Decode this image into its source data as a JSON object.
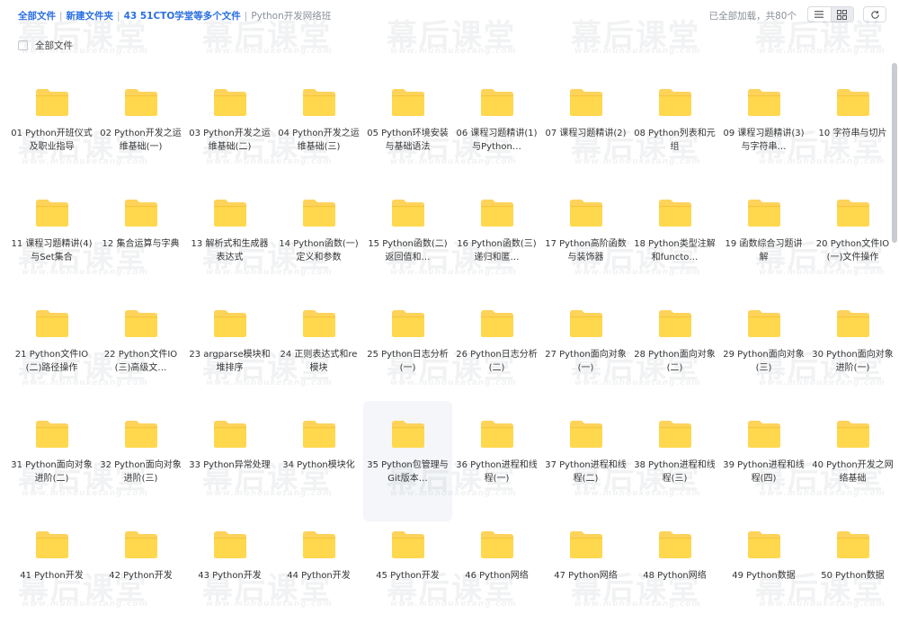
{
  "breadcrumb": {
    "items": [
      "全部文件",
      "新建文件夹",
      "43 51CTO学堂等多个文件"
    ],
    "current": "Python开发网络班",
    "separator": "|"
  },
  "status": {
    "loaded_text": "已全部加载，共80个"
  },
  "toolbar": {
    "list_view_icon": "list-icon",
    "grid_view_icon": "grid-icon",
    "refresh_icon": "refresh-icon",
    "active_view": "grid"
  },
  "select_all": {
    "label": "全部文件",
    "checked": false
  },
  "folder_color": "#fdd35a",
  "folders": [
    "01 Python开班仪式及职业指导",
    "02 Python开发之运维基础(一)",
    "03 Python开发之运维基础(二)",
    "04 Python开发之运维基础(三)",
    "05 Python环境安装与基础语法",
    "06 课程习题精讲(1)与Python…",
    "07 课程习题精讲(2)",
    "08 Python列表和元组",
    "09 课程习题精讲(3)与字符串…",
    "10 字符串与切片",
    "11 课程习题精讲(4)与Set集合",
    "12 集合运算与字典",
    "13 解析式和生成器表达式",
    "14 Python函数(一)定义和参数",
    "15 Python函数(二)返回值和…",
    "16 Python函数(三)递归和匿…",
    "17 Python高阶函数与装饰器",
    "18 Python类型注解和functo…",
    "19 函数综合习题讲解",
    "20 Python文件IO(一)文件操作",
    "21 Python文件IO(二)路径操作",
    "22 Python文件IO(三)高级文…",
    "23 argparse模块和堆排序",
    "24 正则表达式和re模块",
    "25 Python日志分析(一)",
    "26 Python日志分析(二)",
    "27 Python面向对象(一)",
    "28 Python面向对象(二)",
    "29 Python面向对象(三)",
    "30 Python面向对象进阶(一)",
    "31 Python面向对象进阶(二)",
    "32 Python面向对象进阶(三)",
    "33 Python异常处理",
    "34 Python模块化",
    "35 Python包管理与Git版本…",
    "36 Python进程和线程(一)",
    "37 Python进程和线程(二)",
    "38 Python进程和线程(三)",
    "39 Python进程和线程(四)",
    "40 Python开发之网络基础",
    "41 Python开发",
    "42 Python开发",
    "43 Python开发",
    "44 Python开发",
    "45 Python开发",
    "46 Python网络",
    "47 Python网络",
    "48 Python网络",
    "49 Python数据",
    "50 Python数据"
  ],
  "watermark": {
    "text": "幕后课堂",
    "subtext": "www.muhouketang.com"
  }
}
